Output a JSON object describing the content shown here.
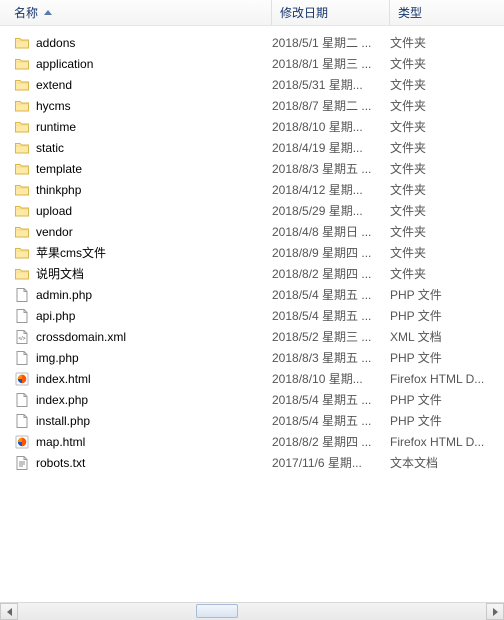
{
  "header": {
    "name": "名称",
    "date": "修改日期",
    "type": "类型"
  },
  "items": [
    {
      "icon": "folder",
      "name": "addons",
      "date": "2018/5/1 星期二 ...",
      "type": "文件夹"
    },
    {
      "icon": "folder",
      "name": "application",
      "date": "2018/8/1 星期三 ...",
      "type": "文件夹"
    },
    {
      "icon": "folder",
      "name": "extend",
      "date": "2018/5/31 星期...",
      "type": "文件夹"
    },
    {
      "icon": "folder",
      "name": "hycms",
      "date": "2018/8/7 星期二 ...",
      "type": "文件夹"
    },
    {
      "icon": "folder",
      "name": "runtime",
      "date": "2018/8/10 星期...",
      "type": "文件夹"
    },
    {
      "icon": "folder",
      "name": "static",
      "date": "2018/4/19 星期...",
      "type": "文件夹"
    },
    {
      "icon": "folder",
      "name": "template",
      "date": "2018/8/3 星期五 ...",
      "type": "文件夹"
    },
    {
      "icon": "folder",
      "name": "thinkphp",
      "date": "2018/4/12 星期...",
      "type": "文件夹"
    },
    {
      "icon": "folder",
      "name": "upload",
      "date": "2018/5/29 星期...",
      "type": "文件夹"
    },
    {
      "icon": "folder",
      "name": "vendor",
      "date": "2018/4/8 星期日 ...",
      "type": "文件夹"
    },
    {
      "icon": "folder",
      "name": "苹果cms文件",
      "date": "2018/8/9 星期四 ...",
      "type": "文件夹"
    },
    {
      "icon": "folder",
      "name": "说明文档",
      "date": "2018/8/2 星期四 ...",
      "type": "文件夹"
    },
    {
      "icon": "php",
      "name": "admin.php",
      "date": "2018/5/4 星期五 ...",
      "type": "PHP 文件"
    },
    {
      "icon": "php",
      "name": "api.php",
      "date": "2018/5/4 星期五 ...",
      "type": "PHP 文件"
    },
    {
      "icon": "xml",
      "name": "crossdomain.xml",
      "date": "2018/5/2 星期三 ...",
      "type": "XML 文档"
    },
    {
      "icon": "php",
      "name": "img.php",
      "date": "2018/8/3 星期五 ...",
      "type": "PHP 文件"
    },
    {
      "icon": "firefox",
      "name": "index.html",
      "date": "2018/8/10 星期...",
      "type": "Firefox HTML D..."
    },
    {
      "icon": "php",
      "name": "index.php",
      "date": "2018/5/4 星期五 ...",
      "type": "PHP 文件"
    },
    {
      "icon": "php",
      "name": "install.php",
      "date": "2018/5/4 星期五 ...",
      "type": "PHP 文件"
    },
    {
      "icon": "firefox",
      "name": "map.html",
      "date": "2018/8/2 星期四 ...",
      "type": "Firefox HTML D..."
    },
    {
      "icon": "txt",
      "name": "robots.txt",
      "date": "2017/11/6 星期...",
      "type": "文本文档"
    }
  ]
}
